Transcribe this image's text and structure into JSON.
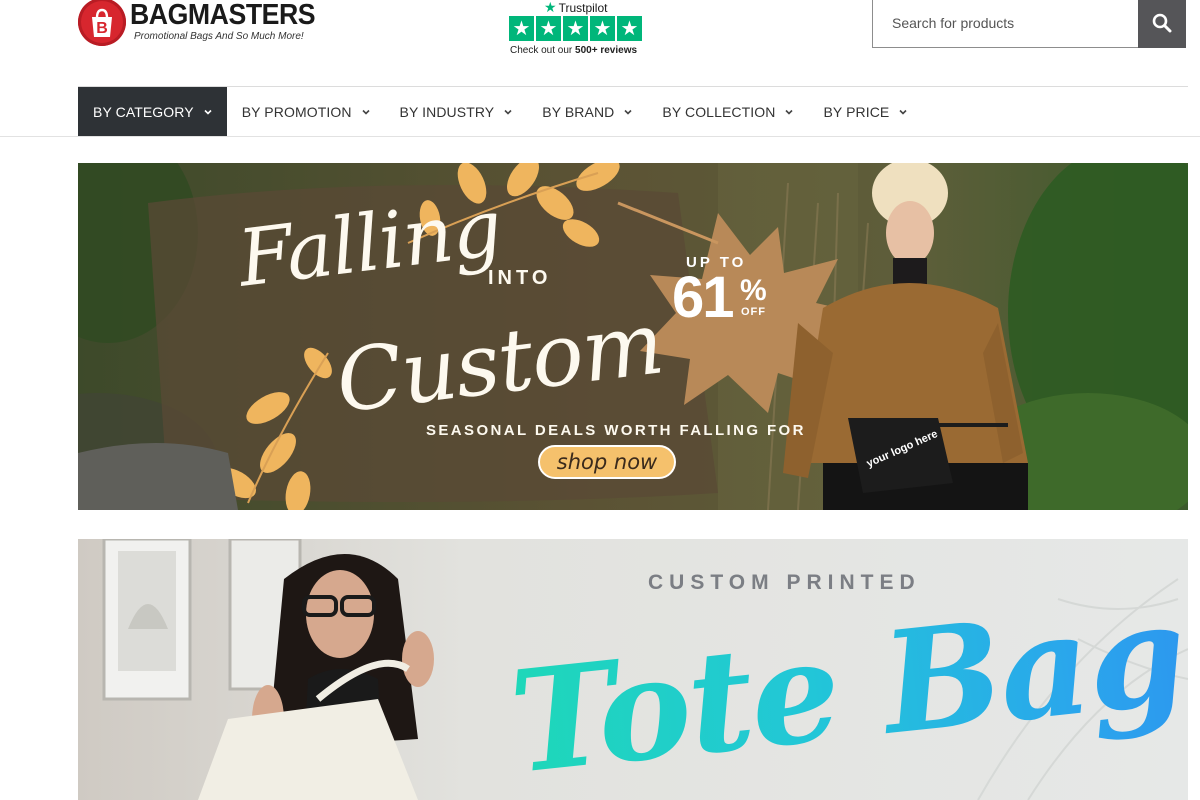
{
  "header": {
    "logo_name": "BAGMASTERS",
    "logo_tagline": "Promotional Bags And So Much More!",
    "logo_letter": "B",
    "trustpilot": {
      "brand": "Trustpilot",
      "caption_pre": "Check out our ",
      "caption_bold": "500+ reviews",
      "stars": 5,
      "color": "#00b67a"
    },
    "search": {
      "placeholder": "Search for products",
      "value": "",
      "button_icon": "search-icon"
    }
  },
  "nav": {
    "items": [
      {
        "label": "BY CATEGORY",
        "active": true
      },
      {
        "label": "BY PROMOTION",
        "active": false
      },
      {
        "label": "BY INDUSTRY",
        "active": false
      },
      {
        "label": "BY BRAND",
        "active": false
      },
      {
        "label": "BY COLLECTION",
        "active": false
      },
      {
        "label": "BY PRICE",
        "active": false
      }
    ]
  },
  "banners": {
    "fall": {
      "title_line1": "Falling",
      "title_into": "INTO",
      "title_line2": "Custom",
      "tagline": "SEASONAL DEALS WORTH FALLING FOR",
      "cta": "shop now",
      "discount_prefix": "UP TO",
      "discount_value": "61",
      "discount_symbol": "%",
      "discount_suffix": "OFF",
      "product_logo_text": "your logo here"
    },
    "tote": {
      "subtitle": "CUSTOM PRINTED",
      "title": "Tote Bags"
    }
  },
  "colors": {
    "nav_active_bg": "#2e3236",
    "brand_red": "#d7262e",
    "cta_bg": "#f5c16c",
    "search_button_bg": "#555558"
  }
}
